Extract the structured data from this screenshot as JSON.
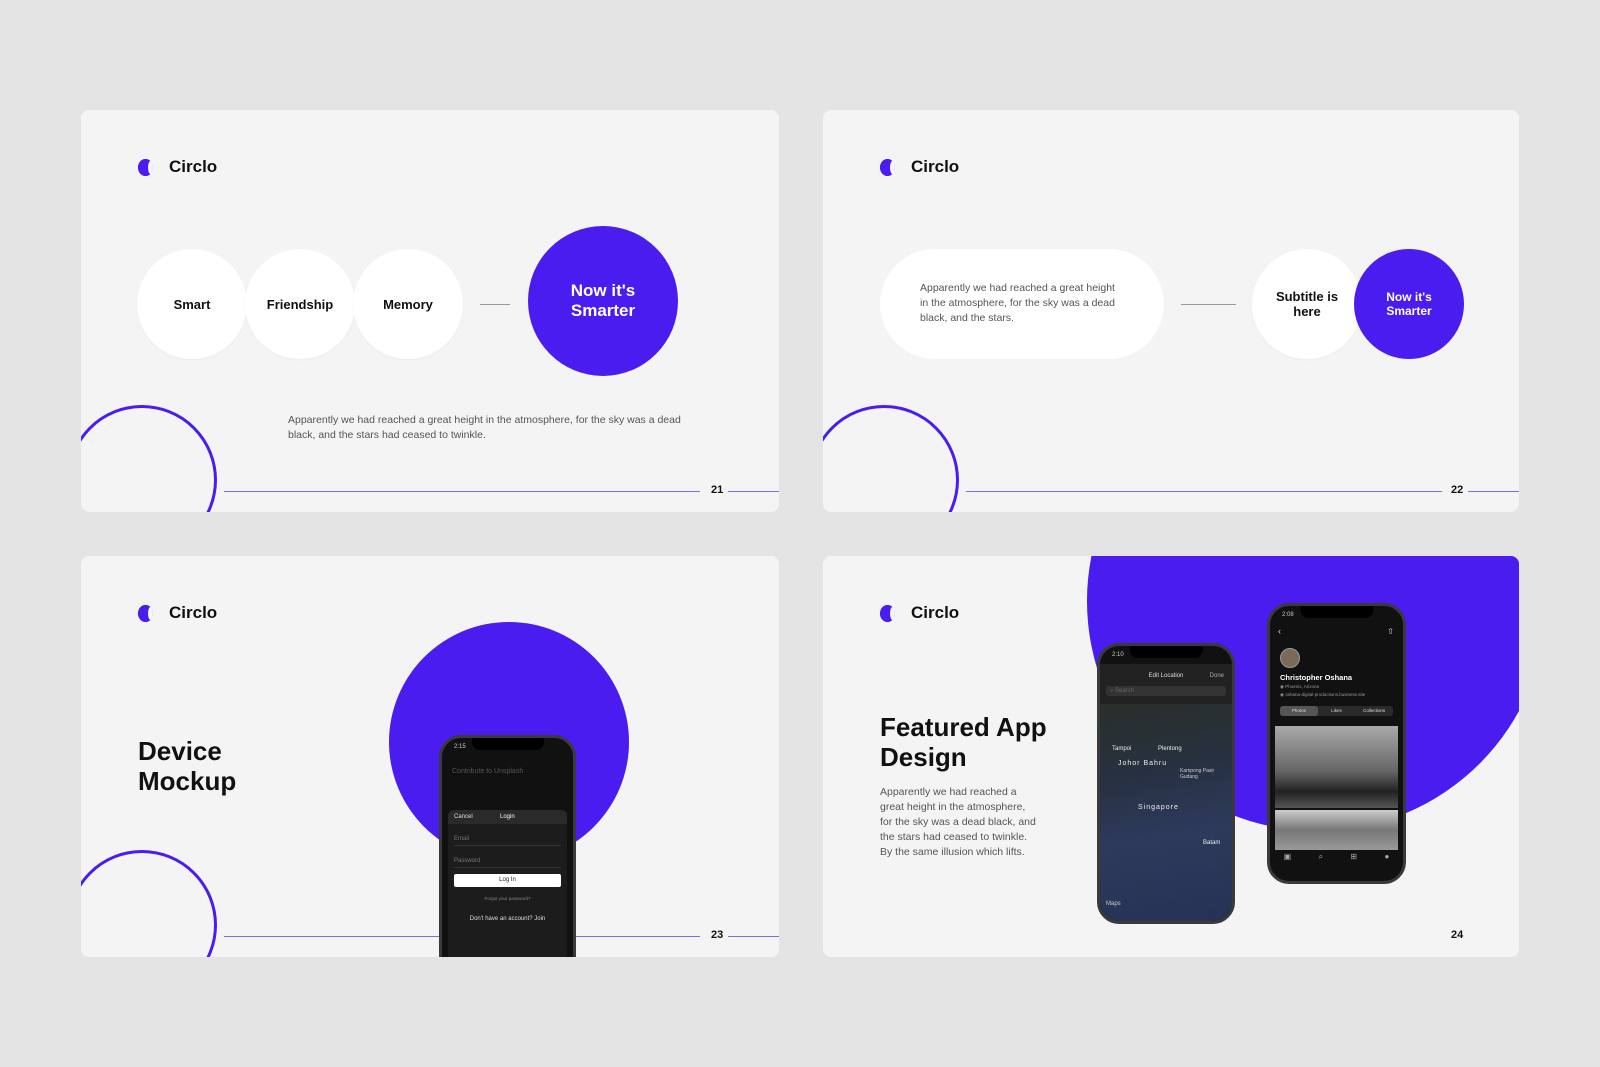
{
  "brand": {
    "name": "Circlo",
    "accent": "#4a1cf0"
  },
  "slides": [
    {
      "number": "21",
      "circles": [
        "Smart",
        "Friendship",
        "Memory"
      ],
      "highlight": "Now it's Smarter",
      "paragraph": "Apparently we had reached a great height in the atmosphere, for the sky was a dead black, and the stars had ceased to twinkle."
    },
    {
      "number": "22",
      "paragraph": "Apparently we had reached a great height in the atmosphere, for the sky was a dead black, and the stars.",
      "subtitle": "Subtitle is here",
      "highlight": "Now it's Smarter"
    },
    {
      "number": "23",
      "title": "Device Mockup",
      "phone": {
        "time": "2:15",
        "heading": "Contribute to Unsplash",
        "cancel": "Cancel",
        "login_title": "Login",
        "email": "Email",
        "password": "Password",
        "login_button": "Log In",
        "forgot": "Forgot your password?",
        "signup": "Don't have an account? Join"
      }
    },
    {
      "number": "24",
      "title": "Featured App Design",
      "paragraph": "Apparently we had reached a great height in the atmosphere, for the sky was a dead black, and the stars had ceased to twinkle. By the same illusion which lifts.",
      "map_phone": {
        "time": "2:10",
        "title": "Edit Location",
        "done": "Done",
        "search": "Search",
        "labels": [
          "Tampoi",
          "Plentong",
          "Johor Bahru",
          "Kampong Pasir Gudang",
          "Singapore",
          "Batam"
        ],
        "maps": "Maps"
      },
      "profile_phone": {
        "time": "2:08",
        "name": "Christopher Oshana",
        "location": "Phoenix, Arizona",
        "website": "oshana-digital-productions.business.site",
        "tabs": [
          "Photos",
          "Likes",
          "Collections"
        ]
      }
    }
  ]
}
